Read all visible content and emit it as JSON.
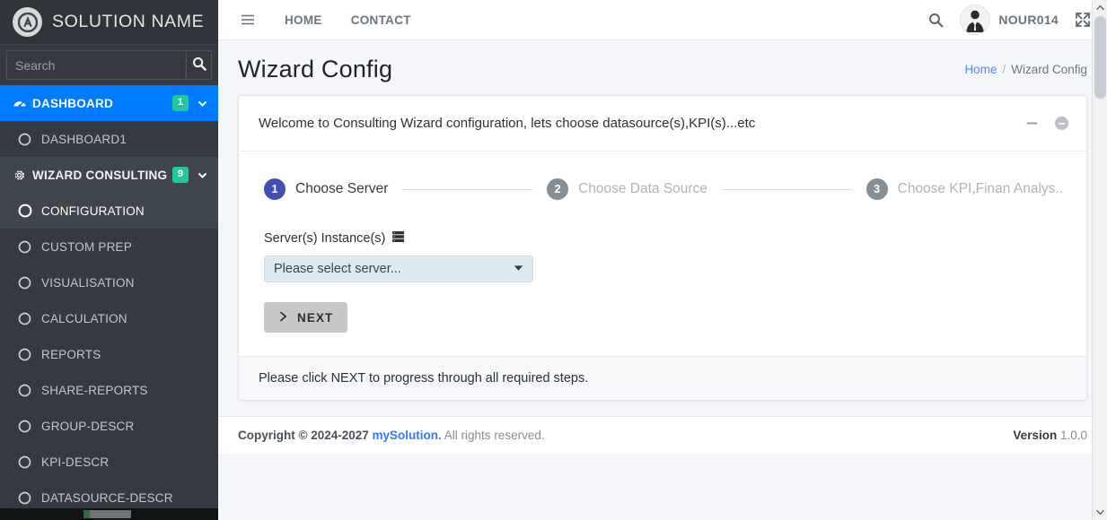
{
  "sidebar": {
    "brand": {
      "title": "SOLUTION NAME",
      "logo_icon": "app-logo-icon"
    },
    "search": {
      "placeholder": "Search",
      "value": "",
      "button_icon": "search-icon"
    },
    "menu": [
      {
        "type": "main",
        "label": "DASHBOARD",
        "icon": "speedometer-icon",
        "badge": "1",
        "chevron": "chevron-down-icon",
        "state": "active"
      },
      {
        "type": "sub",
        "label": "DASHBOARD1",
        "icon": "circle-icon",
        "state": "normal"
      },
      {
        "type": "main",
        "label": "WIZARD CONSULTING",
        "icon": "gear-icon",
        "badge": "9",
        "chevron": "chevron-down-icon",
        "state": "open"
      },
      {
        "type": "sub",
        "label": "CONFIGURATION",
        "icon": "circle-icon",
        "state": "selected"
      },
      {
        "type": "sub",
        "label": "CUSTOM PREP",
        "icon": "circle-icon",
        "state": "normal"
      },
      {
        "type": "sub",
        "label": "VISUALISATION",
        "icon": "circle-icon",
        "state": "normal"
      },
      {
        "type": "sub",
        "label": "CALCULATION",
        "icon": "circle-icon",
        "state": "normal"
      },
      {
        "type": "sub",
        "label": "REPORTS",
        "icon": "circle-icon",
        "state": "normal"
      },
      {
        "type": "sub",
        "label": "SHARE-REPORTS",
        "icon": "circle-icon",
        "state": "normal"
      },
      {
        "type": "sub",
        "label": "GROUP-DESCR",
        "icon": "circle-icon",
        "state": "normal"
      },
      {
        "type": "sub",
        "label": "KPI-DESCR",
        "icon": "circle-icon",
        "state": "normal"
      },
      {
        "type": "sub",
        "label": "DATASOURCE-DESCR",
        "icon": "circle-icon",
        "state": "normal"
      }
    ]
  },
  "topnav": {
    "menu_icon": "hamburger-icon",
    "links": [
      {
        "label": "HOME"
      },
      {
        "label": "CONTACT"
      }
    ],
    "search_icon": "search-icon",
    "fullscreen_icon": "fullscreen-expand-icon",
    "user": {
      "name": "NOUR014",
      "avatar_icon": "user-avatar-icon"
    }
  },
  "page": {
    "title": "Wizard Config",
    "breadcrumb": {
      "home": "Home",
      "separator": "/",
      "current": "Wizard Config"
    }
  },
  "card": {
    "title": "Welcome to Consulting Wizard configuration, lets choose datasource(s),KPI(s)...etc",
    "tools": {
      "collapse_icon": "minus-icon",
      "remove_icon": "circle-minus-icon"
    },
    "footer_text": "Please click NEXT to progress through all required steps."
  },
  "wizard": {
    "steps": [
      {
        "number": "1",
        "label": "Choose Server",
        "state": "active"
      },
      {
        "number": "2",
        "label": "Choose Data Source",
        "state": "inactive"
      },
      {
        "number": "3",
        "label": "Choose KPI,Finan Analys..",
        "state": "inactive"
      }
    ],
    "form": {
      "field_label": "Server(s) Instance(s)",
      "field_icon": "server-rack-icon",
      "select": {
        "value": "Please select server...",
        "caret_icon": "caret-down-icon",
        "options": [
          "Please select server..."
        ]
      },
      "next_button": {
        "label": "NEXT",
        "icon": "chevron-right-icon"
      }
    }
  },
  "footer": {
    "copyright_prefix": "Copyright © 2024-2027",
    "brand": "mySolution.",
    "rights": "All rights reserved.",
    "version_label": "Version",
    "version_number": "1.0.0"
  },
  "colors": {
    "sidebar_bg": "#343a40",
    "active_blue": "#007bff",
    "badge_teal": "#20c997",
    "step_active": "#3f51b5",
    "link_blue": "#2f7bf6",
    "select_bg": "#deeaf2"
  }
}
